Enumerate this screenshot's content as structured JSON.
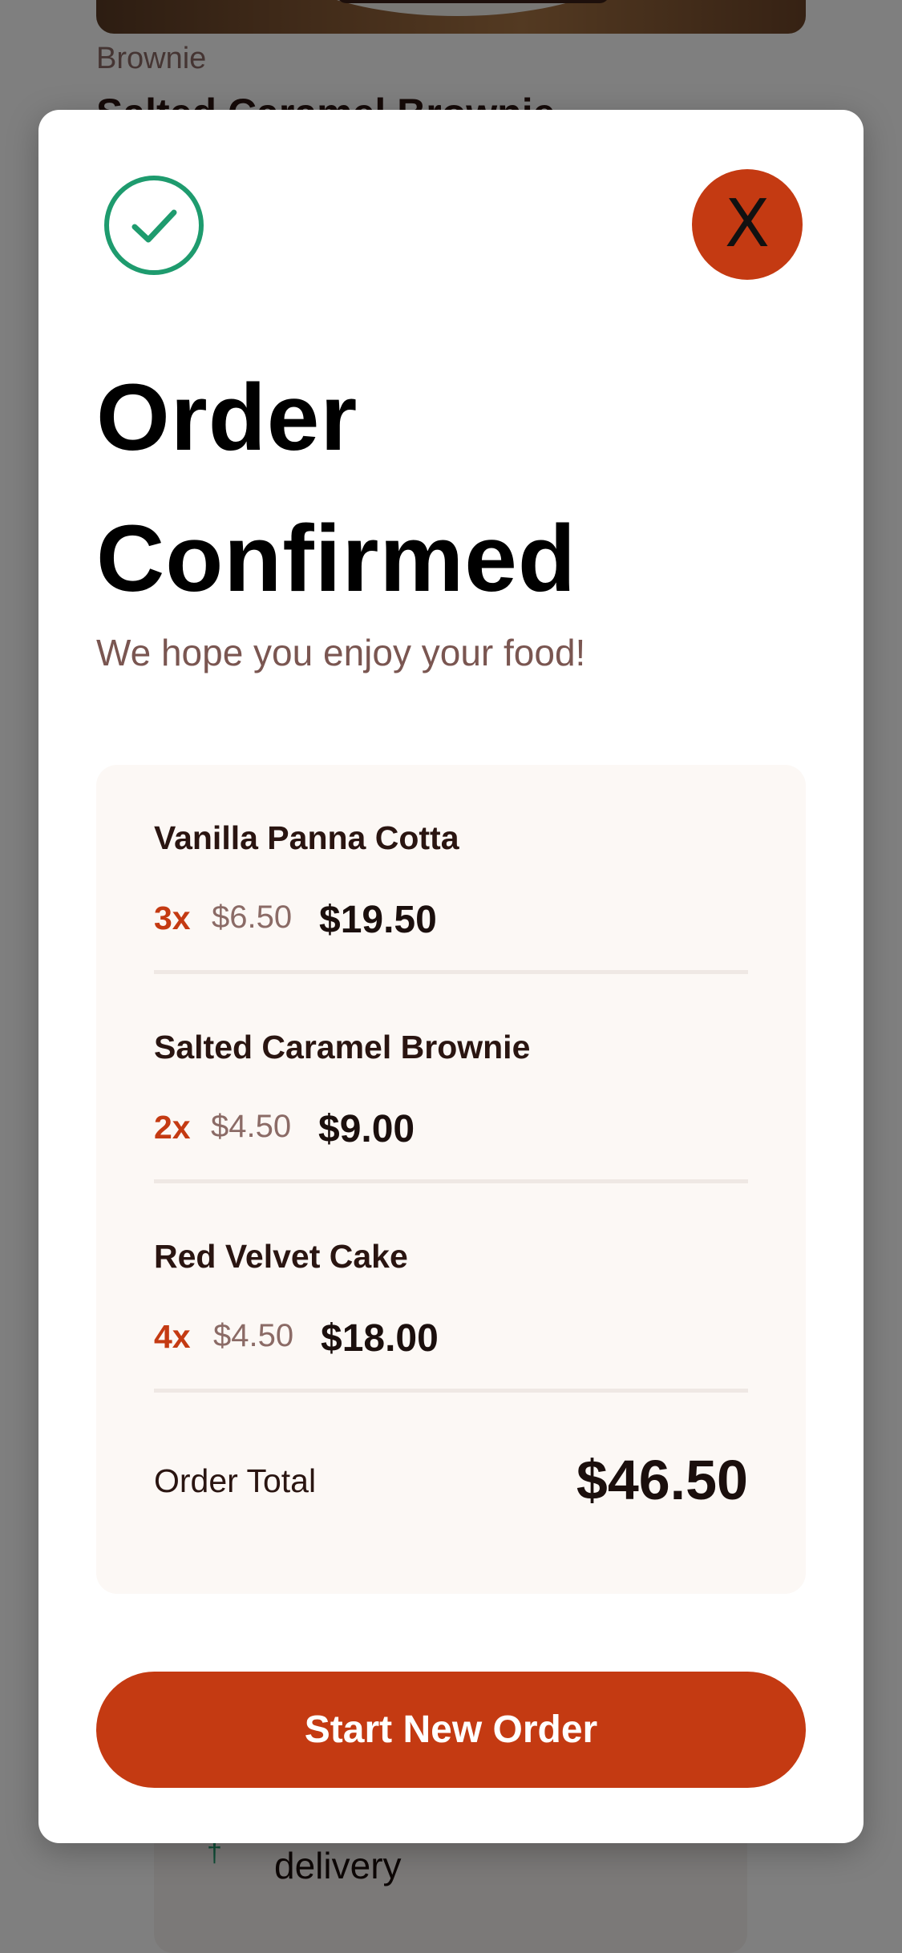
{
  "background": {
    "category": "Brownie",
    "product_title": "Salted Caramel Brownie",
    "delivery_text": "delivery"
  },
  "modal": {
    "success_icon": "check-circle-icon",
    "close_label": "X",
    "title": "Order Confirmed",
    "subtitle": "We hope you enjoy your food!",
    "items": [
      {
        "name": "Vanilla Panna Cotta",
        "quantity": "3x",
        "unit_price": "$6.50",
        "line_total": "$19.50"
      },
      {
        "name": "Salted Caramel Brownie",
        "quantity": "2x",
        "unit_price": "$4.50",
        "line_total": "$9.00"
      },
      {
        "name": "Red Velvet Cake",
        "quantity": "4x",
        "unit_price": "$4.50",
        "line_total": "$18.00"
      }
    ],
    "total_label": "Order Total",
    "total_value": "$46.50",
    "cta_label": "Start New Order"
  },
  "colors": {
    "accent": "#c43a12",
    "success": "#1e9b6e",
    "muted_text": "#8b6b66",
    "card_bg": "#fcf8f5"
  }
}
